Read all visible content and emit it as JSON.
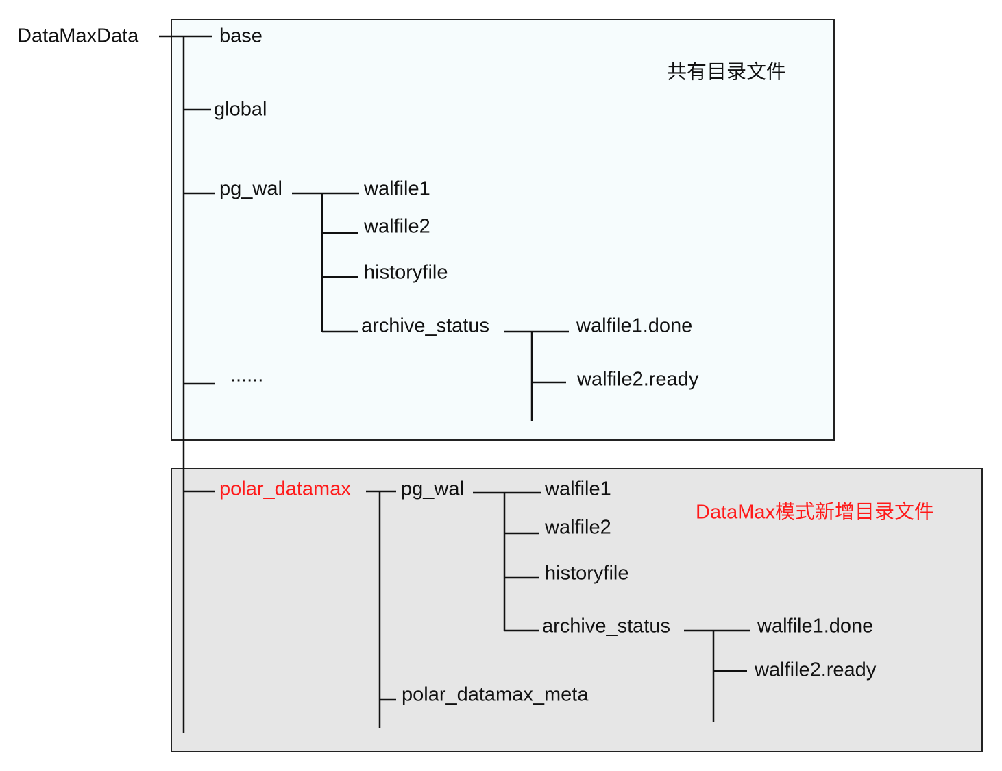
{
  "root": "DataMaxData",
  "shared": {
    "caption": "共有目录文件",
    "base": "base",
    "global": "global",
    "pg_wal": "pg_wal",
    "walfile1": "walfile1",
    "walfile2": "walfile2",
    "historyfile": "historyfile",
    "archive_status": "archive_status",
    "done": "walfile1.done",
    "ready": "walfile2.ready",
    "ellipsis": "......"
  },
  "datamax": {
    "caption": "DataMax模式新增目录文件",
    "polar_datamax": "polar_datamax",
    "pg_wal": "pg_wal",
    "walfile1": "walfile1",
    "walfile2": "walfile2",
    "historyfile": "historyfile",
    "archive_status": "archive_status",
    "done": "walfile1.done",
    "ready": "walfile2.ready",
    "meta": "polar_datamax_meta"
  },
  "colors": {
    "highlight": "#ff1a1a",
    "shared_bg": "#f6fcfd",
    "datamax_bg": "#e6e6e6"
  }
}
